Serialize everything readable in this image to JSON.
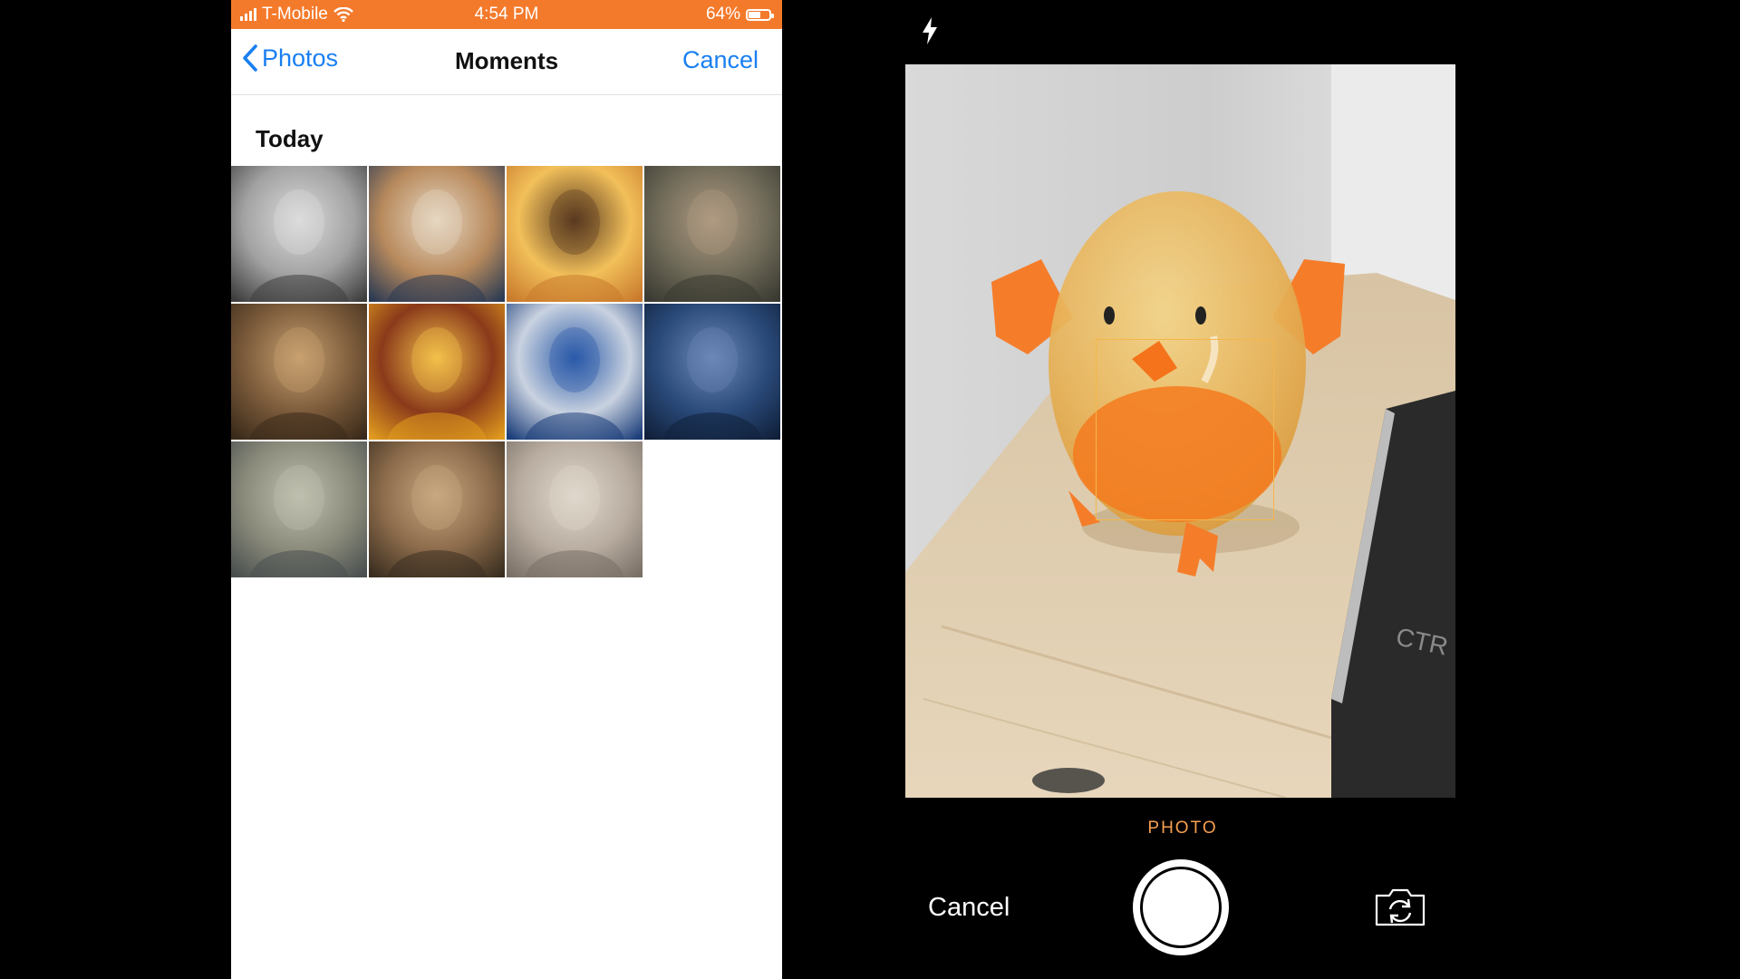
{
  "status_bar": {
    "carrier": "T-Mobile",
    "time": "4:54 PM",
    "battery_text": "64%",
    "battery_level": 0.64
  },
  "nav": {
    "back_label": "Photos",
    "title": "Moments",
    "cancel_label": "Cancel"
  },
  "section": {
    "title": "Today"
  },
  "photos": [
    {
      "name": "photo-1",
      "palette": [
        "#3e3e3e",
        "#a2a2a2",
        "#dcdcdc"
      ]
    },
    {
      "name": "photo-2",
      "palette": [
        "#2c3b53",
        "#b88a5d",
        "#e6d7c2"
      ]
    },
    {
      "name": "photo-3",
      "palette": [
        "#c97a2c",
        "#f2c05a",
        "#5a3a20"
      ]
    },
    {
      "name": "photo-4",
      "palette": [
        "#3a3a32",
        "#6f6a58",
        "#b09a82"
      ]
    },
    {
      "name": "photo-5",
      "palette": [
        "#3a2a1a",
        "#7a5a3a",
        "#c8a070"
      ]
    },
    {
      "name": "photo-6",
      "palette": [
        "#e09a1e",
        "#8a3a1a",
        "#f3c04a"
      ]
    },
    {
      "name": "photo-7",
      "palette": [
        "#1c3e7a",
        "#c9d2e0",
        "#2a5aa8"
      ]
    },
    {
      "name": "photo-8",
      "palette": [
        "#10203a",
        "#2a4a7a",
        "#6c88b8"
      ]
    },
    {
      "name": "photo-9",
      "palette": [
        "#4a5050",
        "#8a8a7a",
        "#c0c0b0"
      ]
    },
    {
      "name": "photo-10",
      "palette": [
        "#3a2e20",
        "#8a6a4a",
        "#c8a880"
      ]
    },
    {
      "name": "photo-11",
      "palette": [
        "#7a7066",
        "#b8aca0",
        "#e0d8cc"
      ]
    }
  ],
  "camera": {
    "mode": "PHOTO",
    "cancel_label": "Cancel"
  },
  "colors": {
    "accent_blue": "#1a7ff1",
    "status_orange": "#f47a2b",
    "mode_orange": "#f6a04f"
  },
  "icons": {
    "back": "chevron-left-icon",
    "flash": "flash-icon",
    "flip": "camera-flip-icon",
    "shutter": "shutter-icon"
  }
}
